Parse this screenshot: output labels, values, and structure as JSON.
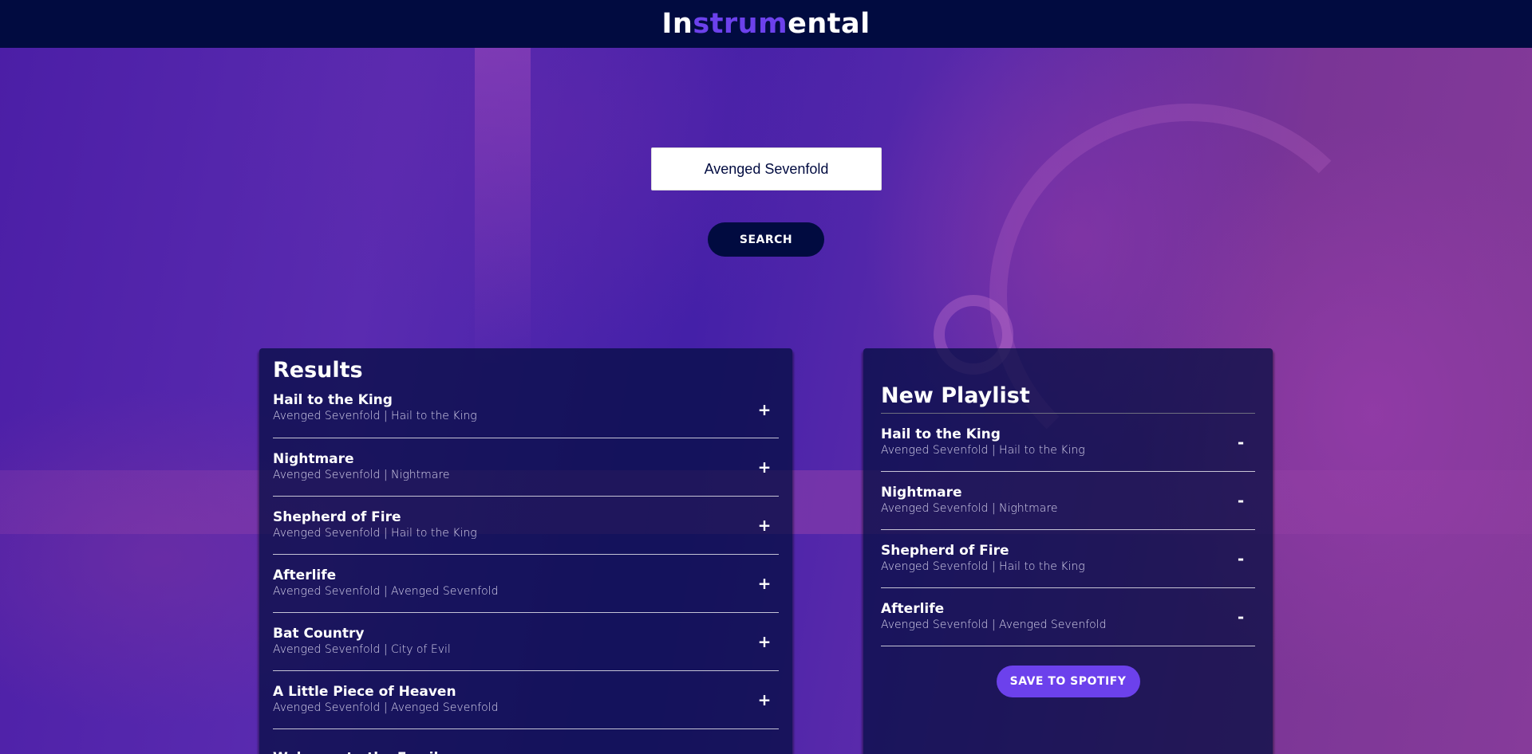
{
  "app": {
    "logo_prefix": "In",
    "logo_accent": "strum",
    "logo_suffix": "ental"
  },
  "colors": {
    "header_bg": "#010b40",
    "accent": "#6c41ec",
    "panel_bg": "#010c3f"
  },
  "search": {
    "value": "Avenged Sevenfold",
    "button_label": "SEARCH"
  },
  "results": {
    "title": "Results",
    "action_icon": "plus-icon",
    "tracks": [
      {
        "name": "Hail to the King",
        "meta": "Avenged Sevenfold | Hail to the King",
        "action": "+"
      },
      {
        "name": "Nightmare",
        "meta": "Avenged Sevenfold | Nightmare",
        "action": "+"
      },
      {
        "name": "Shepherd of Fire",
        "meta": "Avenged Sevenfold | Hail to the King",
        "action": "+"
      },
      {
        "name": "Afterlife",
        "meta": "Avenged Sevenfold | Avenged Sevenfold",
        "action": "+"
      },
      {
        "name": "Bat Country",
        "meta": "Avenged Sevenfold | City of Evil",
        "action": "+"
      },
      {
        "name": "A Little Piece of Heaven",
        "meta": "Avenged Sevenfold | Avenged Sevenfold",
        "action": "+"
      },
      {
        "name": "Welcome to the Family",
        "meta": "",
        "action": ""
      }
    ]
  },
  "playlist": {
    "name": "New Playlist",
    "action_icon": "minus-icon",
    "tracks": [
      {
        "name": "Hail to the King",
        "meta": "Avenged Sevenfold | Hail to the King",
        "action": "-"
      },
      {
        "name": "Nightmare",
        "meta": "Avenged Sevenfold | Nightmare",
        "action": "-"
      },
      {
        "name": "Shepherd of Fire",
        "meta": "Avenged Sevenfold | Hail to the King",
        "action": "-"
      },
      {
        "name": "Afterlife",
        "meta": "Avenged Sevenfold | Avenged Sevenfold",
        "action": "-"
      }
    ],
    "save_label": "SAVE TO SPOTIFY"
  }
}
